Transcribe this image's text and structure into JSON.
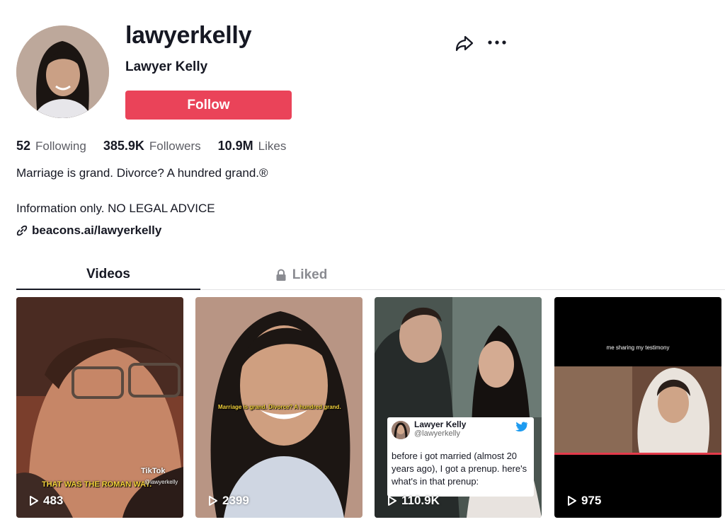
{
  "profile": {
    "username": "lawyerkelly",
    "nickname": "Lawyer Kelly",
    "follow_label": "Follow",
    "stats": [
      {
        "value": "52",
        "label": "Following"
      },
      {
        "value": "385.9K",
        "label": "Followers"
      },
      {
        "value": "10.9M",
        "label": "Likes"
      }
    ],
    "bio_line1": "Marriage is grand. Divorce? A hundred grand.®",
    "bio_line2": "Information only. NO LEGAL ADVICE",
    "link": "beacons.ai/lawyerkelly"
  },
  "actions": {
    "share_icon": "share-arrow-icon",
    "more_icon": "more-dots-icon"
  },
  "tabs": [
    {
      "label": "Videos",
      "active": true
    },
    {
      "label": "Liked",
      "active": false,
      "icon": "lock-icon"
    }
  ],
  "videos": [
    {
      "views": "483",
      "caption": "THAT WAS THE ROMAN WAY.",
      "watermark": "TikTok",
      "watermark_handle": "@lawyerkelly"
    },
    {
      "views": "2399",
      "caption": "Marriage is grand. Divorce? A hundred grand."
    },
    {
      "views": "110.9K",
      "tweet": {
        "name": "Lawyer Kelly",
        "handle": "@lawyerkelly",
        "body": "before i got married (almost 20 years ago), I got a prenup.  here's what's in that prenup:"
      }
    },
    {
      "views": "975",
      "caption": "me sharing my testimony"
    }
  ],
  "colors": {
    "follow": "#ea4359",
    "text": "#161823",
    "muted": "#8a8b91",
    "caption_yellow": "#f4d23c"
  }
}
